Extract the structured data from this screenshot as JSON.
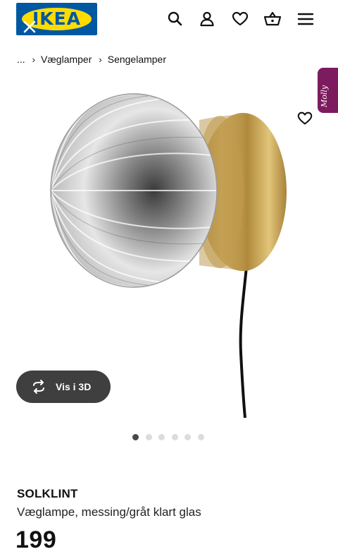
{
  "header": {
    "logo_text": "IKEA",
    "icons": [
      "search-icon",
      "account-icon",
      "heart-icon",
      "basket-icon",
      "menu-icon"
    ]
  },
  "breadcrumb": {
    "ellipsis": "...",
    "items": [
      "Væglamper",
      "Sengelamper"
    ]
  },
  "chat": {
    "label": "Molly"
  },
  "gallery": {
    "view3d_label": "Vis i 3D",
    "image_count": 6,
    "active_index": 0
  },
  "product": {
    "name": "SOLKLINT",
    "description": "Væglampe, messing/gråt klart glas",
    "price": "199"
  },
  "colors": {
    "ikea_blue": "#0058a3",
    "ikea_yellow": "#ffdb00",
    "chat_purple": "#7c1b5e",
    "button_dark": "#3f3f3f"
  }
}
